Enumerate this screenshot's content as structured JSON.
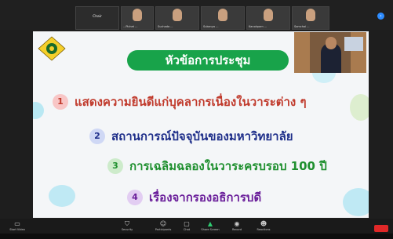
{
  "participants": [
    {
      "name": "Chair",
      "label": ""
    },
    {
      "name": "",
      "label": "...Pichet ..."
    },
    {
      "name": "",
      "label": "Suchada ..."
    },
    {
      "name": "",
      "label": "Sukanya ..."
    },
    {
      "name": "",
      "label": "Kanokporn ..."
    },
    {
      "name": "",
      "label": "Somchai ..."
    }
  ],
  "slide": {
    "title": "หัวข้อการประชุม",
    "items": [
      {
        "num": "1",
        "text": "แสดงความยินดีแก่บุคลากรเนื่องในวาระต่าง ๆ"
      },
      {
        "num": "2",
        "text": "สถานการณ์ปัจจุบันของมหาวิทยาลัย"
      },
      {
        "num": "3",
        "text": "การเฉลิมฉลองในวาระครบรอบ 100 ปี"
      },
      {
        "num": "4",
        "text": "เรื่องจากรองอธิการบดี"
      }
    ],
    "colors": {
      "title_bg": "#18a34a",
      "item1": "#c0392b",
      "item2": "#1f2f8a",
      "item3": "#1e8f2e",
      "item4": "#6a1e9a"
    }
  },
  "toolbar": {
    "buttons": [
      {
        "icon": "mic-icon",
        "label": "Start Video"
      },
      {
        "icon": "security-icon",
        "label": "Security"
      },
      {
        "icon": "participants-icon",
        "label": "Participants"
      },
      {
        "icon": "chat-icon",
        "label": "Chat"
      },
      {
        "icon": "share-screen-icon",
        "label": "Share Screen"
      },
      {
        "icon": "record-icon",
        "label": "Record"
      },
      {
        "icon": "reactions-icon",
        "label": "Reactions"
      }
    ],
    "end_label": ""
  }
}
